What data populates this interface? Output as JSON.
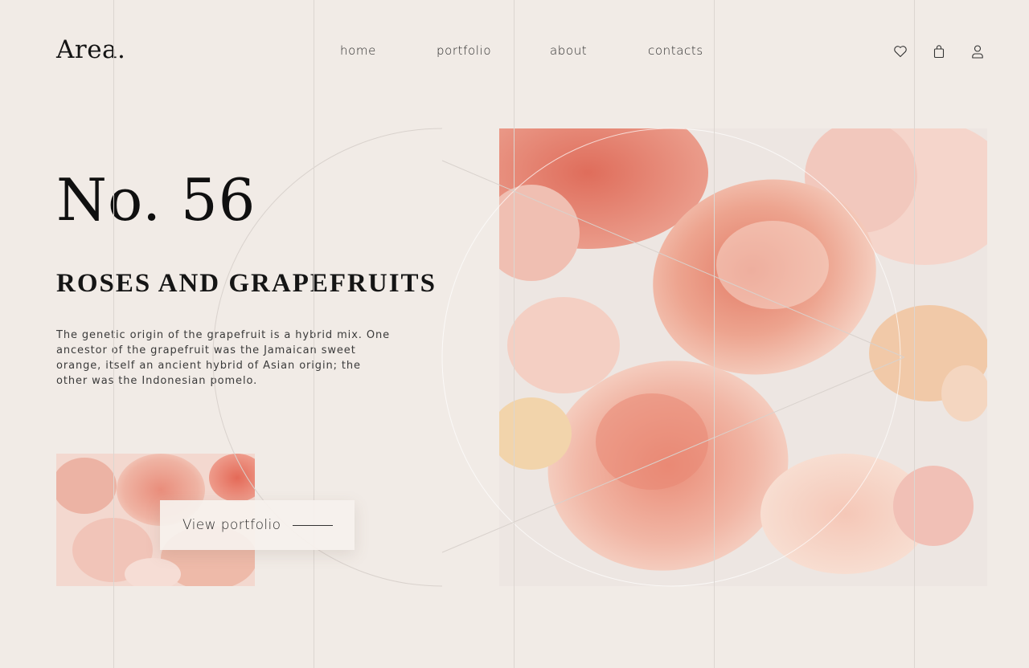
{
  "brand": {
    "logo": "Area."
  },
  "nav": {
    "items": [
      {
        "label": "home"
      },
      {
        "label": "portfolio"
      },
      {
        "label": "about"
      },
      {
        "label": "contacts"
      }
    ]
  },
  "header_icons": [
    "heart-icon",
    "shopping-bag-icon",
    "user-icon"
  ],
  "hero": {
    "number": "No. 56",
    "title": "ROSES AND GRAPEFRUITS",
    "description": "The genetic origin of the grapefruit is a hybrid mix. One ancestor of the grapefruit was the Jamaican sweet orange, itself an ancient hybrid of Asian origin; the other was the Indonesian pomelo."
  },
  "cta": {
    "label": "View portfolio"
  },
  "colors": {
    "background": "#f1ebe6",
    "text": "#1b1b1b",
    "guide": "#dcd6d1",
    "peach": "#e9a592",
    "pink": "#efc9c2",
    "coral": "#df7f6b"
  }
}
